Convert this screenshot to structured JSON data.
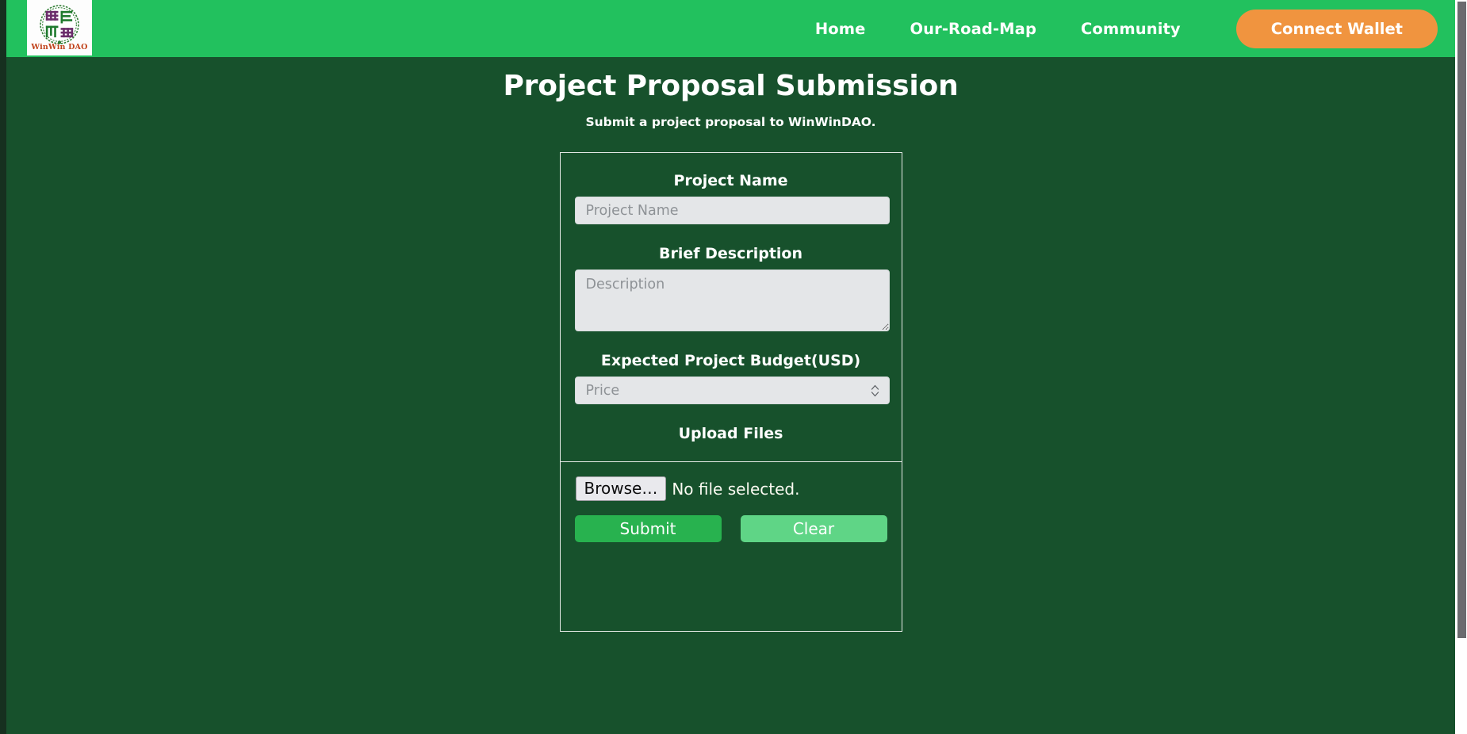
{
  "brand": {
    "name": "WinWin DAO",
    "logo_icon": "winwin-dao-circular-emblem",
    "logo_colors": {
      "purple": "#6b2d6b",
      "green": "#1f7a2e",
      "text": "#c0421a"
    }
  },
  "theme": {
    "navbar_green": "#22c15e",
    "page_green": "#17512c",
    "accent_orange": "#f0943f",
    "submit_green": "#28b24f",
    "clear_green": "#5fd586",
    "input_gray": "#e4e6e8"
  },
  "nav": {
    "links": [
      {
        "label": "Home"
      },
      {
        "label": "Our-Road-Map"
      },
      {
        "label": "Community"
      }
    ],
    "connect_wallet_label": "Connect Wallet"
  },
  "header": {
    "title": "Project Proposal Submission",
    "subtitle": "Submit a project proposal to WinWinDAO."
  },
  "form": {
    "project_name": {
      "label": "Project Name",
      "placeholder": "Project Name",
      "value": ""
    },
    "description": {
      "label": "Brief Description",
      "placeholder": "Description",
      "value": ""
    },
    "budget": {
      "label": "Expected Project Budget(USD)",
      "placeholder": "Price",
      "value": "",
      "stepper_icon": "up-down-chevron-stepper-icon"
    },
    "upload": {
      "label": "Upload Files",
      "browse_label": "Browse…",
      "file_status": "No file selected."
    },
    "actions": {
      "submit_label": "Submit",
      "clear_label": "Clear"
    }
  },
  "scrollbar": {
    "orientation": "vertical",
    "position": "right"
  }
}
